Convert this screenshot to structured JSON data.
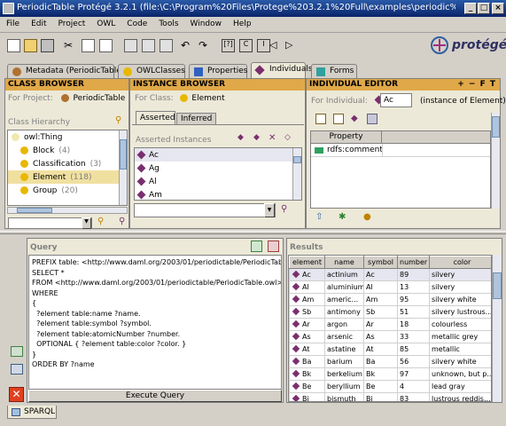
{
  "window": {
    "title": "PeriodicTable  Protégé 3.2.1    (file:\\C:\\Program%20Files\\Protege%203.2.1%20Full\\examples\\periodic%20table..."
  },
  "menu": [
    "File",
    "Edit",
    "Project",
    "OWL",
    "Code",
    "Tools",
    "Window",
    "Help"
  ],
  "logo": "protégé",
  "tabs": [
    {
      "label": "Metadata (PeriodicTable)",
      "icon": "metadata-icon"
    },
    {
      "label": "OWLClasses",
      "icon": "owl-classes-icon"
    },
    {
      "label": "Properties",
      "icon": "properties-icon"
    },
    {
      "label": "Individuals",
      "icon": "individuals-icon"
    },
    {
      "label": "Forms",
      "icon": "forms-icon"
    }
  ],
  "class_browser": {
    "header": "CLASS BROWSER",
    "for_project_label": "For Project:",
    "project": "PeriodicTable",
    "hierarchy_label": "Class Hierarchy",
    "items": [
      {
        "label": "owl:Thing",
        "count": ""
      },
      {
        "label": "Block",
        "count": "(4)"
      },
      {
        "label": "Classification",
        "count": "(3)"
      },
      {
        "label": "Element",
        "count": "(118)"
      },
      {
        "label": "Group",
        "count": "(20)"
      }
    ]
  },
  "instance_browser": {
    "header": "INSTANCE BROWSER",
    "for_class_label": "For Class:",
    "class": "Element",
    "tab_asserted": "Asserted",
    "tab_inferred": "Inferred",
    "instances_label": "Asserted Instances",
    "items": [
      "Ac",
      "Ag",
      "Al",
      "Am"
    ]
  },
  "individual_editor": {
    "header": "INDIVIDUAL EDITOR",
    "header_controls": "+ − F T",
    "for_individual_label": "For Individual:",
    "individual": "Ac",
    "instance_of": "(instance of Element)",
    "property_header": "Property",
    "property": "rdfs:comment"
  },
  "query": {
    "header": "Query",
    "lines": [
      "PREFIX table: <http://www.daml.org/2003/01/periodictable/PeriodicTable#>",
      "SELECT *",
      "FROM <http://www.daml.org/2003/01/periodictable/PeriodicTable.owl>",
      "WHERE",
      "{",
      "  ?element table:name ?name.",
      "  ?element table:symbol ?symbol.",
      "  ?element table:atomicNumber ?number.",
      "  OPTIONAL { ?element table:color ?color. }",
      "}",
      "ORDER BY ?name"
    ],
    "execute_label": "Execute Query"
  },
  "results": {
    "header": "Results",
    "columns": [
      "element",
      "name",
      "symbol",
      "number",
      "color"
    ],
    "rows": [
      [
        "Ac",
        "actinium",
        "Ac",
        "89",
        "silvery"
      ],
      [
        "Al",
        "aluminium",
        "Al",
        "13",
        "silvery"
      ],
      [
        "Am",
        "americ...",
        "Am",
        "95",
        "silvery white"
      ],
      [
        "Sb",
        "antimony",
        "Sb",
        "51",
        "silvery lustrous..."
      ],
      [
        "Ar",
        "argon",
        "Ar",
        "18",
        "colourless"
      ],
      [
        "As",
        "arsenic",
        "As",
        "33",
        "metallic grey"
      ],
      [
        "At",
        "astatine",
        "At",
        "85",
        "metallic"
      ],
      [
        "Ba",
        "barium",
        "Ba",
        "56",
        "silvery white"
      ],
      [
        "Bk",
        "berkelium",
        "Bk",
        "97",
        "unknown, but p..."
      ],
      [
        "Be",
        "beryllium",
        "Be",
        "4",
        "lead gray"
      ],
      [
        "Bi",
        "bismuth",
        "Bi",
        "83",
        "lustrous reddis..."
      ],
      [
        "Bh",
        "bohrium",
        "Bh",
        "107",
        "unknown, but p..."
      ]
    ]
  },
  "bottom_tab": "SPARQL"
}
